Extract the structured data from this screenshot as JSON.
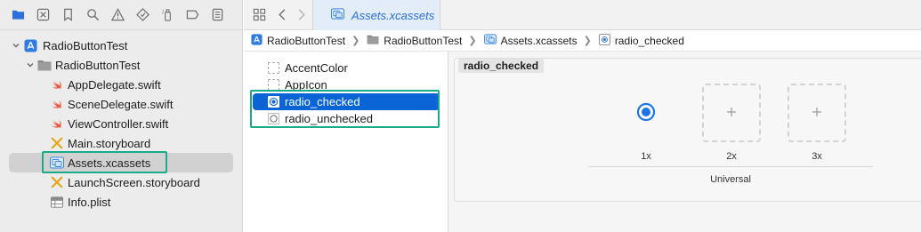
{
  "navigator": {
    "toolbar_icons": [
      "folder-icon",
      "source-control-icon",
      "bookmark-icon",
      "find-icon",
      "issue-warning-icon",
      "test-diamond-icon",
      "debug-spray-icon",
      "breakpoint-icon",
      "report-icon"
    ],
    "tree": [
      {
        "label": "RadioButtonTest",
        "icon": "app-project-icon",
        "level": 0,
        "expanded": true
      },
      {
        "label": "RadioButtonTest",
        "icon": "folder-icon",
        "level": 1,
        "expanded": true
      },
      {
        "label": "AppDelegate.swift",
        "icon": "swift-icon",
        "level": 2
      },
      {
        "label": "SceneDelegate.swift",
        "icon": "swift-icon",
        "level": 2
      },
      {
        "label": "ViewController.swift",
        "icon": "swift-icon",
        "level": 2
      },
      {
        "label": "Main.storyboard",
        "icon": "storyboard-icon",
        "level": 2
      },
      {
        "label": "Assets.xcassets",
        "icon": "asset-catalog-icon",
        "level": 2,
        "selected": true
      },
      {
        "label": "LaunchScreen.storyboard",
        "icon": "storyboard-icon",
        "level": 2
      },
      {
        "label": "Info.plist",
        "icon": "plist-table-icon",
        "level": 2
      }
    ]
  },
  "tabbar": {
    "active_tab_label": "Assets.xcassets"
  },
  "jumpbar": {
    "crumbs": [
      "RadioButtonTest",
      "RadioButtonTest",
      "Assets.xcassets",
      "radio_checked"
    ]
  },
  "assetlist": {
    "items": [
      {
        "label": "AccentColor"
      },
      {
        "label": "AppIcon"
      },
      {
        "label": "radio_checked",
        "selected": true
      },
      {
        "label": "radio_unchecked"
      }
    ]
  },
  "editor": {
    "set_name": "radio_checked",
    "slots": [
      "1x",
      "2x",
      "3x"
    ],
    "group_label": "Universal"
  },
  "colors": {
    "selection_blue": "#0a64d6",
    "highlight_green": "#1aab8a",
    "accent_blue": "#2a6fdb",
    "swift_orange": "#f05138"
  }
}
